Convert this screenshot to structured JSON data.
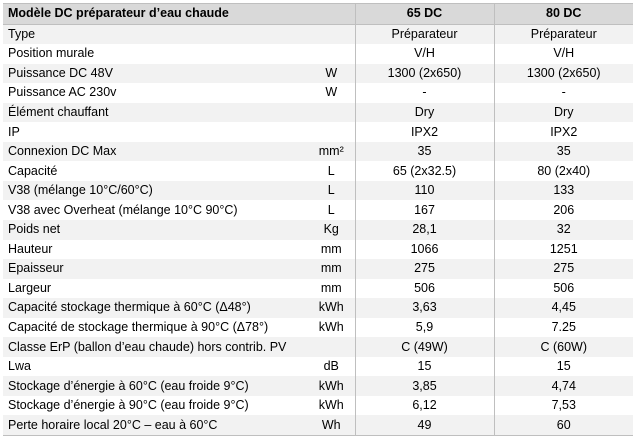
{
  "table": {
    "header": {
      "label": "Modèle DC préparateur d’eau chaude",
      "unit": "",
      "model_65": "65 DC",
      "model_80": "80 DC"
    },
    "rows": [
      {
        "label": "Type",
        "unit": "",
        "v65": "Préparateur",
        "v80": "Préparateur"
      },
      {
        "label": "Position murale",
        "unit": "",
        "v65": "V/H",
        "v80": "V/H"
      },
      {
        "label": "Puissance DC 48V",
        "unit": "W",
        "v65": "1300 (2x650)",
        "v80": "1300 (2x650)"
      },
      {
        "label": "Puissance AC 230v",
        "unit": "W",
        "v65": "-",
        "v80": "-"
      },
      {
        "label": "Élément chauffant",
        "unit": "",
        "v65": "Dry",
        "v80": "Dry"
      },
      {
        "label": "IP",
        "unit": "",
        "v65": "IPX2",
        "v80": "IPX2"
      },
      {
        "label": "Connexion DC Max",
        "unit": "mm²",
        "v65": "35",
        "v80": "35"
      },
      {
        "label": "Capacité",
        "unit": "L",
        "v65": "65 (2x32.5)",
        "v80": "80 (2x40)"
      },
      {
        "label": "V38 (mélange 10°C/60°C)",
        "unit": "L",
        "v65": "110",
        "v80": "133"
      },
      {
        "label": "V38 avec Overheat (mélange 10°C 90°C)",
        "unit": "L",
        "v65": "167",
        "v80": "206"
      },
      {
        "label": "Poids net",
        "unit": "Kg",
        "v65": "28,1",
        "v80": "32"
      },
      {
        "label": "Hauteur",
        "unit": "mm",
        "v65": "1066",
        "v80": "1251"
      },
      {
        "label": "Epaisseur",
        "unit": "mm",
        "v65": "275",
        "v80": "275"
      },
      {
        "label": "Largeur",
        "unit": "mm",
        "v65": "506",
        "v80": "506"
      },
      {
        "label": "Capacité stockage thermique à 60°C (Δ48°)",
        "unit": "kWh",
        "v65": "3,63",
        "v80": "4,45"
      },
      {
        "label": "Capacité de stockage thermique à 90°C (Δ78°)",
        "unit": "kWh",
        "v65": "5,9",
        "v80": "7.25"
      },
      {
        "label": "Classe ErP (ballon d’eau chaude) hors contrib. PV",
        "unit": "",
        "v65": "C (49W)",
        "v80": "C (60W)"
      },
      {
        "label": "Lwa",
        "unit": "dB",
        "v65": "15",
        "v80": "15"
      },
      {
        "label": "Stockage d’énergie à 60°C (eau froide 9°C)",
        "unit": "kWh",
        "v65": "3,85",
        "v80": "4,74"
      },
      {
        "label": "Stockage d’énergie à 90°C (eau froide 9°C)",
        "unit": "kWh",
        "v65": "6,12",
        "v80": "7,53"
      },
      {
        "label": "Perte horaire local 20°C – eau à 60°C",
        "unit": "Wh",
        "v65": "49",
        "v80": "60"
      }
    ]
  }
}
